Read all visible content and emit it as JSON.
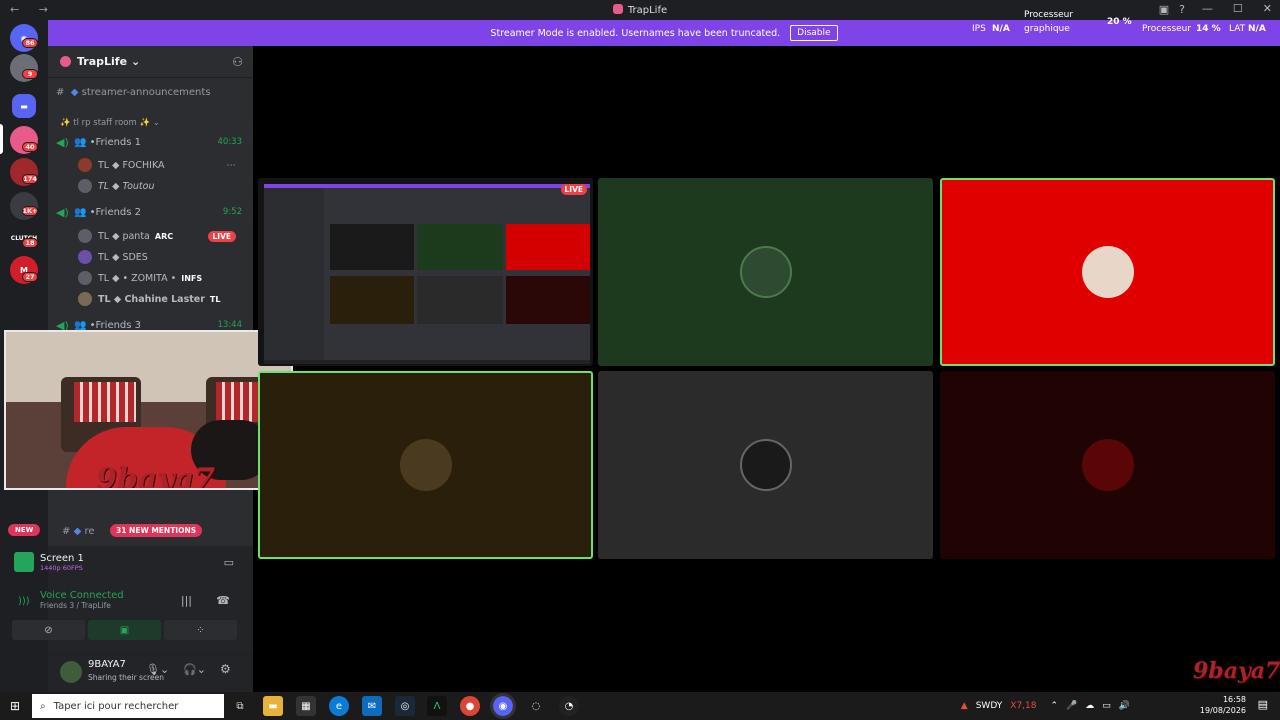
{
  "window": {
    "title": "TrapLife"
  },
  "banner": {
    "text": "Streamer Mode is enabled. Usernames have been truncated.",
    "button": "Disable"
  },
  "overlay": {
    "gpu_label_1": "Processeur",
    "gpu_label_2": "graphique",
    "gpu_value": "20 %",
    "ips_label": "IPS",
    "ips_value": "N/A",
    "cpu_label": "Processeur",
    "cpu_value": "14 %",
    "lat_label": "LAT",
    "lat_value": "N/A"
  },
  "guilds": {
    "items": [
      {
        "badge": "86",
        "color": "#5865f2"
      },
      {
        "badge": "9",
        "color": "#6b6f75"
      },
      {
        "badge": "",
        "color": "#5865f2"
      },
      {
        "badge": "40",
        "color": "#e85a8a"
      },
      {
        "badge": "174",
        "color": "#a0282b"
      },
      {
        "badge": "1K+",
        "color": "#3a3c41"
      },
      {
        "badge": "18",
        "color": "#1e1f22",
        "label": "CLUTCH"
      },
      {
        "badge": "27",
        "color": "#d21d2a"
      }
    ]
  },
  "server": {
    "name": "TrapLife"
  },
  "channels": {
    "announcements": "streamer-announcements",
    "category": "✨ tl rp staff room ✨",
    "voice": [
      {
        "name": "Friends 1",
        "time": "40:33"
      },
      {
        "name": "Friends 2",
        "time": "9:52"
      },
      {
        "name": "Friends 3",
        "time": "13:44"
      }
    ],
    "friends1_members": [
      {
        "name": "TL ◆ FOCHIKA",
        "tag": "",
        "extra": "⋯"
      },
      {
        "name": "TL ◆ Toutou",
        "tag": "",
        "extra": ""
      }
    ],
    "friends2_members": [
      {
        "name": "TL ◆ panta",
        "tag": "ARC",
        "live": "LIVE"
      },
      {
        "name": "TL ◆ SDES",
        "tag": "",
        "live": ""
      },
      {
        "name": "TL ◆ • ZOMITA •",
        "tag": "INFS",
        "live": ""
      },
      {
        "name": "TL ◆ Chahine Laster",
        "tag": "TL",
        "live": ""
      }
    ],
    "bottom_channel": "re",
    "mentions": "31 NEW MENTIONS",
    "new": "NEW"
  },
  "webcam": {
    "brand": "9baya7"
  },
  "stream_panel": {
    "title": "Screen 1",
    "quality": "1440p 60FPS",
    "voice_status": "Voice Connected",
    "voice_location": "Friends 3 / TrapLife"
  },
  "user": {
    "name": "9BAYA7",
    "status": "Sharing their screen"
  },
  "grid": {
    "live": "LIVE"
  },
  "taskbar": {
    "search_placeholder": "Taper ici pour rechercher",
    "ticker": "SWDY",
    "ticker_value": "X7,18",
    "time": "16:58",
    "date": "19/08/2026"
  },
  "watermark": "9baya7"
}
